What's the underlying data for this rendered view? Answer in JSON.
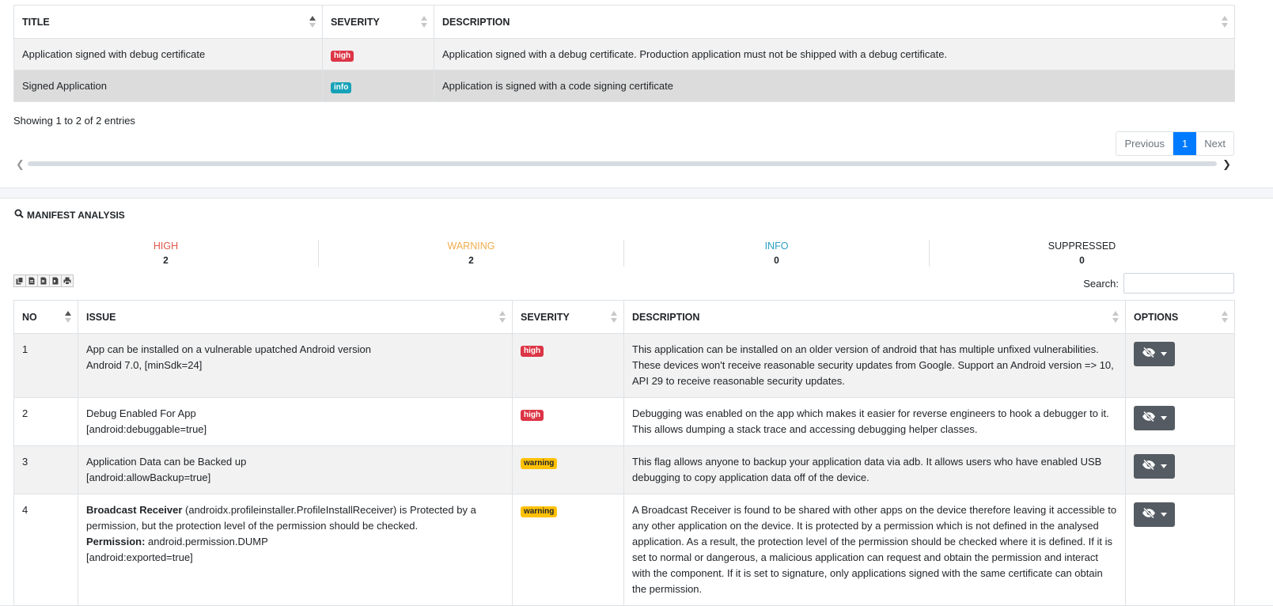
{
  "top_table": {
    "headers": [
      "TITLE",
      "SEVERITY",
      "DESCRIPTION"
    ],
    "rows": [
      {
        "title": "Application signed with debug certificate",
        "severity": "high",
        "description": "Application signed with a debug certificate. Production application must not be shipped with a debug certificate."
      },
      {
        "title": "Signed Application",
        "severity": "info",
        "description": "Application is signed with a code signing certificate"
      }
    ],
    "showing": "Showing 1 to 2 of 2 entries",
    "pagination": {
      "previous": "Previous",
      "current": "1",
      "next": "Next"
    }
  },
  "manifest": {
    "section_title": "MANIFEST ANALYSIS",
    "stats": {
      "high": {
        "label": "HIGH",
        "count": "2"
      },
      "warning": {
        "label": "WARNING",
        "count": "2"
      },
      "info": {
        "label": "INFO",
        "count": "0"
      },
      "suppressed": {
        "label": "SUPPRESSED",
        "count": "0"
      }
    },
    "search_label": "Search:",
    "search_value": "",
    "headers": [
      "NO",
      "ISSUE",
      "SEVERITY",
      "DESCRIPTION",
      "OPTIONS"
    ],
    "rows": [
      {
        "no": "1",
        "issue_title": "App can be installed on a vulnerable upatched Android version",
        "issue_detail": "Android 7.0, [minSdk=24]",
        "severity": "high",
        "description": "This application can be installed on an older version of android that has multiple unfixed vulnerabilities. These devices won't receive reasonable security updates from Google. Support an Android version => 10, API 29 to receive reasonable security updates."
      },
      {
        "no": "2",
        "issue_title": "Debug Enabled For App",
        "issue_detail": "[android:debuggable=true]",
        "severity": "high",
        "description": "Debugging was enabled on the app which makes it easier for reverse engineers to hook a debugger to it. This allows dumping a stack trace and accessing debugging helper classes."
      },
      {
        "no": "3",
        "issue_title": "Application Data can be Backed up",
        "issue_detail": "[android:allowBackup=true]",
        "severity": "warning",
        "description": "This flag allows anyone to backup your application data via adb. It allows users who have enabled USB debugging to copy application data off of the device."
      },
      {
        "no": "4",
        "issue_bold": "Broadcast Receiver",
        "issue_rest": " (androidx.profileinstaller.ProfileInstallReceiver) is Protected by a permission, but the protection level of the permission should be checked.",
        "permission_label": "Permission:",
        "permission_value": " android.permission.DUMP",
        "issue_detail": "[android:exported=true]",
        "severity": "warning",
        "description": "A Broadcast Receiver is found to be shared with other apps on the device therefore leaving it accessible to any other application on the device. It is protected by a permission which is not defined in the analysed application. As a result, the protection level of the permission should be checked where it is defined. If it is set to normal or dangerous, a malicious application can request and obtain the permission and interact with the component. If it is set to signature, only applications signed with the same certificate can obtain the permission."
      }
    ]
  },
  "colors": {
    "high": "#dc3545",
    "warning": "#ffc107",
    "info": "#17a2b8",
    "primary": "#007bff",
    "stat_high": "#e0574a",
    "stat_warning": "#f0ad4e",
    "stat_info": "#2e9fc3"
  },
  "icons": {
    "section": "search-icon",
    "options": "eye-slash-icon",
    "exports": [
      "copy-icon",
      "csv-icon",
      "excel-icon",
      "pdf-icon",
      "print-icon"
    ]
  }
}
